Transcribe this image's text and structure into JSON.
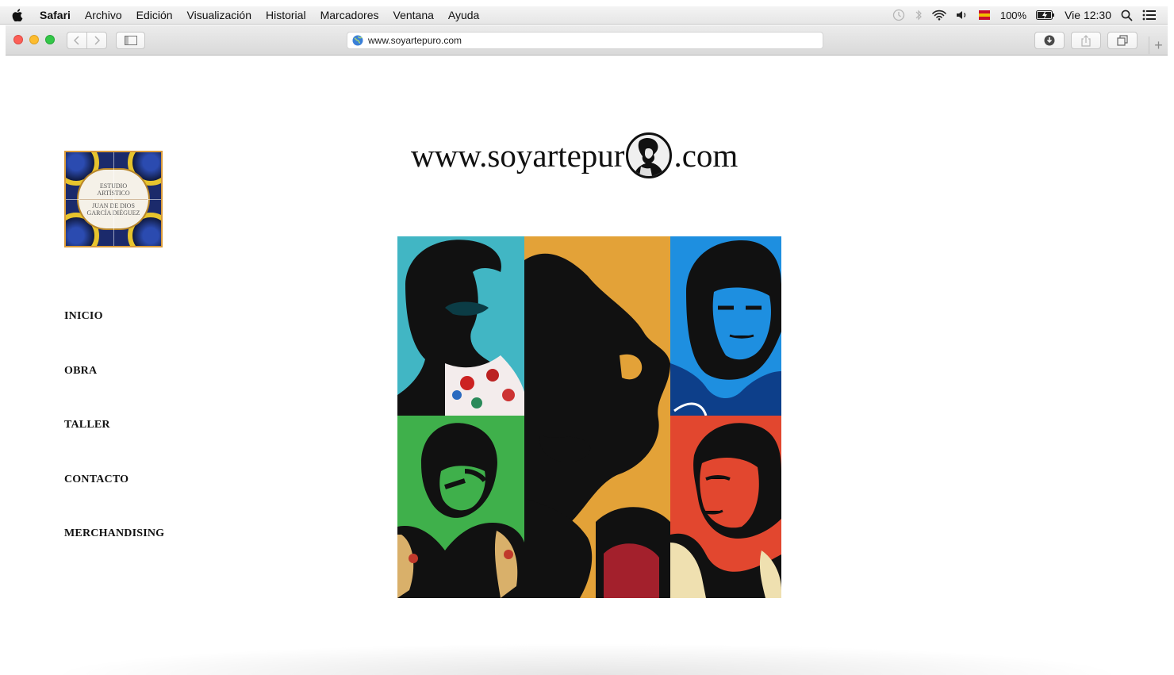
{
  "menubar": {
    "app": "Safari",
    "items": [
      "Archivo",
      "Edición",
      "Visualización",
      "Historial",
      "Marcadores",
      "Ventana",
      "Ayuda"
    ],
    "battery": "100%",
    "clock": "Vie 12:30",
    "input_source": "ISO"
  },
  "browser": {
    "url": "www.soyartepuro.com"
  },
  "site": {
    "logo": {
      "line1": "ESTUDIO",
      "line2": "ARTÍSTICO",
      "line3": "JUAN DE DIOS",
      "line4": "GARCÍA DIÉGUEZ"
    },
    "title_prefix": "www.soyartepur",
    "title_suffix": ".com",
    "nav": [
      "INICIO",
      "OBRA",
      "TALLER",
      "CONTACTO",
      "MERCHANDISING"
    ],
    "artwork_colors": {
      "teal": "#41b6c4",
      "green": "#3fb04b",
      "orange": "#e3a238",
      "blue": "#1e8fe0",
      "red": "#e2472f"
    }
  }
}
